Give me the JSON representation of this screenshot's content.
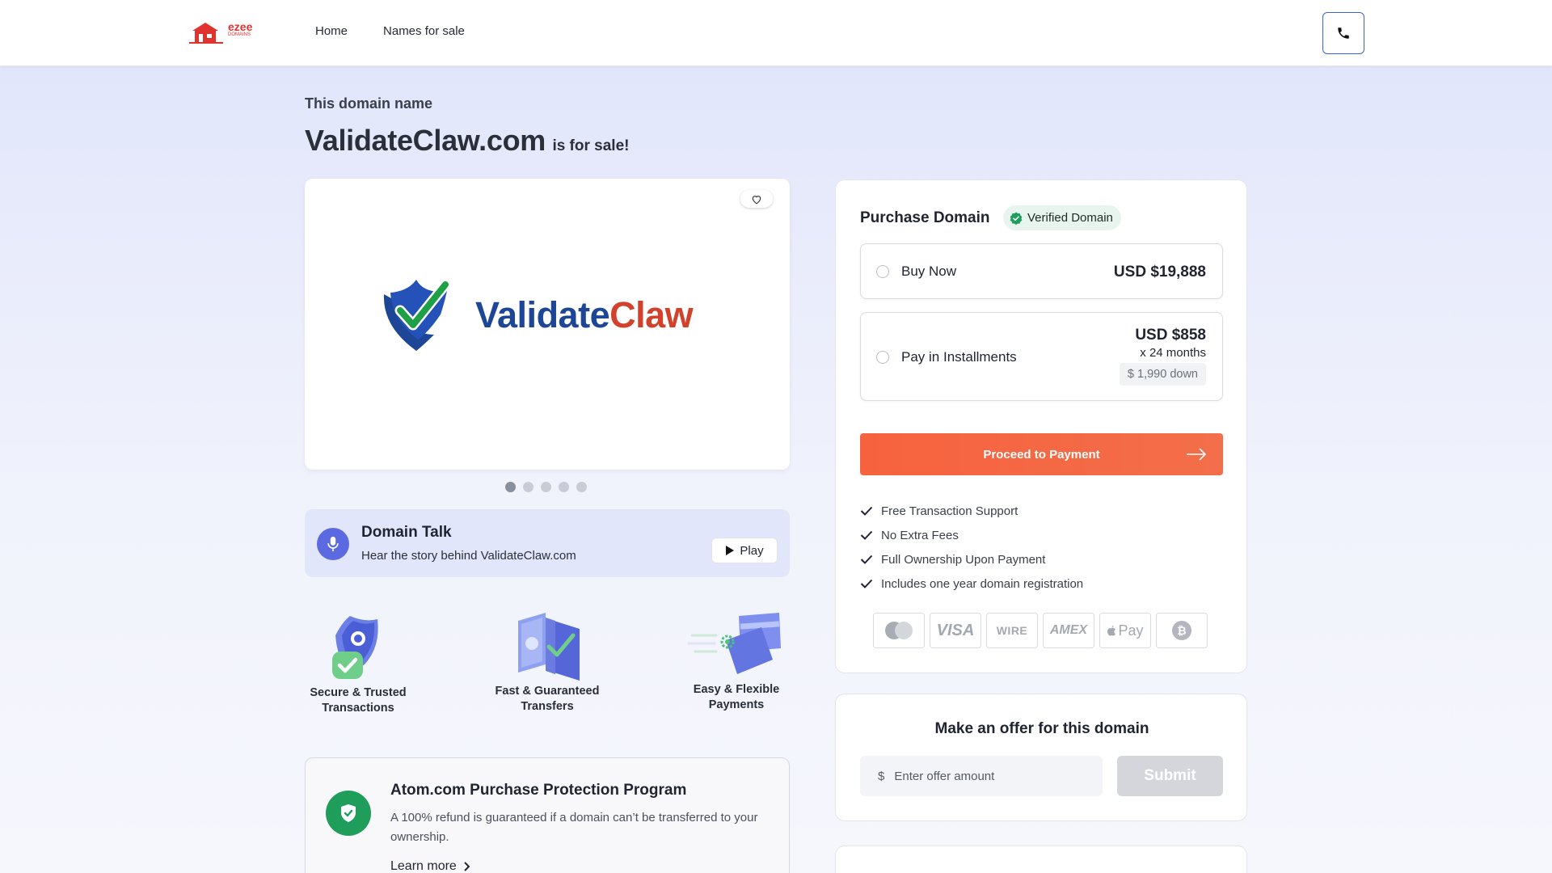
{
  "header": {
    "logo_text": "ezee",
    "logo_sub": "DOMAINS",
    "nav": [
      "Home",
      "Names for sale"
    ]
  },
  "hero": {
    "intro": "This domain name",
    "domain": "ValidateClaw.com",
    "suffix": "is for sale!"
  },
  "brand": {
    "part1": "Validate",
    "part2": "Claw"
  },
  "carousel": {
    "slides": 5,
    "active": 1
  },
  "talk": {
    "title": "Domain Talk",
    "subtitle": "Hear the story behind ValidateClaw.com",
    "play_label": "Play"
  },
  "features": [
    {
      "line1": "Secure & Trusted",
      "line2": "Transactions"
    },
    {
      "line1": "Fast & Guaranteed",
      "line2": "Transfers"
    },
    {
      "line1": "Easy & Flexible",
      "line2": "Payments"
    }
  ],
  "protection": {
    "title": "Atom.com Purchase Protection Program",
    "description": "A 100% refund is guaranteed if a domain can’t be transferred to your ownership.",
    "link": "Learn more"
  },
  "purchase": {
    "title": "Purchase Domain",
    "verified_label": "Verified Domain",
    "buy_now": {
      "label": "Buy Now",
      "price": "USD $19,888"
    },
    "installments": {
      "label": "Pay in Installments",
      "price": "USD $858",
      "term": "x 24 months",
      "down": "$ 1,990 down"
    },
    "proceed_label": "Proceed to Payment",
    "benefits": [
      "Free Transaction Support",
      "No Extra Fees",
      "Full Ownership Upon Payment",
      "Includes one year domain registration"
    ],
    "payment_methods": [
      "mastercard-icon",
      "VISA",
      "WIRE",
      "AMEX",
      "Pay",
      "bitcoin-icon"
    ]
  },
  "offer": {
    "title": "Make an offer for this domain",
    "currency": "$",
    "placeholder": "Enter offer amount",
    "submit_label": "Submit"
  },
  "colors": {
    "accent_orange": "#f7623e",
    "brand_blue": "#1d4796",
    "brand_red": "#d2412c",
    "verified_green": "#1f9d5a",
    "phone_border": "#3a63d9"
  }
}
